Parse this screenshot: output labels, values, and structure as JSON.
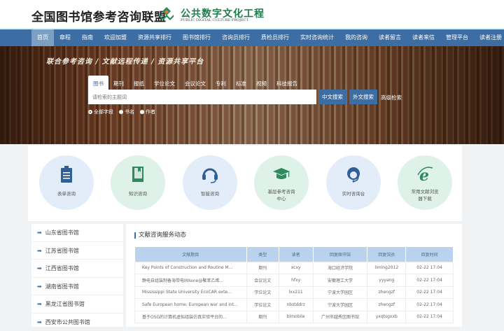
{
  "header": {
    "site_title": "全国图书馆参考咨询联盟",
    "logo_cn": "公共数字文化工程",
    "logo_en": "PUBLIC DIGITAL CULTURE PROJECT"
  },
  "nav": {
    "items": [
      "首页",
      "章程",
      "指南",
      "欢迎加盟",
      "资源共享排行",
      "图书馆排行",
      "咨询员排行",
      "质检员排行",
      "实时咨询统计",
      "我的咨询",
      "读者留言",
      "读者来信",
      "管理平台",
      "读者注册"
    ],
    "active": 0
  },
  "banner": {
    "slogan": "联合参考咨询 / 文献远程传递 / 资源共享平台",
    "search_tabs": [
      "图书",
      "期刊",
      "报纸",
      "学位论文",
      "会议论文",
      "专利",
      "标准",
      "视频",
      "科技报告"
    ],
    "active_tab": 0,
    "placeholder": "请检索的主题词",
    "btn_cn": "中文搜索",
    "btn_foreign": "外文搜索",
    "advanced": "高级检索",
    "radios": [
      "全部字段",
      "书名",
      "作者"
    ],
    "selected_radio": 0
  },
  "services": [
    {
      "label": "表单咨询",
      "icon": "clipboard-icon"
    },
    {
      "label": "知识咨询",
      "icon": "book-icon"
    },
    {
      "label": "智能咨询",
      "icon": "headset-icon"
    },
    {
      "label": "基层参考咨询中心",
      "icon": "graduation-cap-icon"
    },
    {
      "label": "实时咨询台",
      "icon": "agent-icon"
    },
    {
      "label": "常用文献浏览器下载",
      "icon": "ie-browser-icon"
    }
  ],
  "sidebar": {
    "items": [
      "山东省图书馆",
      "江苏省图书馆",
      "江西省图书馆",
      "湖南省图书馆",
      "黑龙江省图书馆",
      "西安市公共图书馆"
    ]
  },
  "main": {
    "title": "文献咨询服务动态",
    "columns": [
      "文献题目",
      "类型",
      "读者",
      "回复图书馆",
      "回复馆员",
      "回复时间"
    ],
    "rows": [
      [
        "Key Points of Construction and Routine M...",
        "期刊",
        "xcxy",
        "海口经济学院",
        "liming2012",
        "02-22 17:04"
      ],
      [
        "静电自组装制备海带电MXene@聚苯乙烯...",
        "会议论文",
        "hfxy",
        "安徽理工大学",
        "yyyang",
        "02-22 17:04"
      ],
      [
        "Mississippi State University EcoCAR exte...",
        "学位论文",
        "lxx211",
        "宁波大学园区",
        "zhengzf",
        "02-22 17:04"
      ],
      [
        "Safe European home: European war and int...",
        "学位论文",
        "nbstddrz",
        "宁波大学园区",
        "zhengzf",
        "02-22 17:04"
      ],
      [
        "基于OSG的计算机虚拟组装仿真实验平台的...",
        "期刊",
        "blmobile",
        "广州市越秀区图书馆",
        "yxqtsgxxb",
        "02-22 17:04"
      ]
    ]
  },
  "colors": {
    "nav": "#3c6ea4",
    "header_row": "#b9d3ef",
    "svc_blue": "#e3edf9",
    "svc_green": "#dff2e9",
    "icon_blue": "#2f5f96",
    "icon_green": "#2f8a5f"
  }
}
